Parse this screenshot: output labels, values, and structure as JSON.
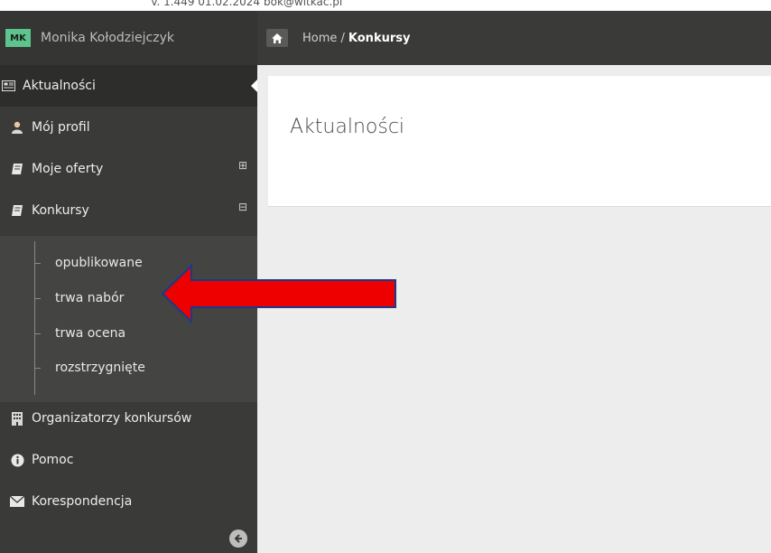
{
  "top": {
    "version": "v. 1.449 01.02.2024",
    "email_hint": "bok@witkac.pl"
  },
  "user": {
    "initials": "MK",
    "name": "Monika Kołodziejczyk"
  },
  "breadcrumb": {
    "home": "Home /",
    "current": "Konkursy"
  },
  "nav": {
    "items": [
      {
        "label": "Aktualności",
        "icon": "newspaper-icon"
      },
      {
        "label": "Mój profil",
        "icon": "user-icon"
      },
      {
        "label": "Moje oferty",
        "icon": "book-icon",
        "toggle": "⊞"
      },
      {
        "label": "Konkursy",
        "icon": "book-icon",
        "toggle": "⊟"
      },
      {
        "label": "Organizatorzy konkursów",
        "icon": "building-icon"
      },
      {
        "label": "Pomoc",
        "icon": "info-icon"
      },
      {
        "label": "Korespondencja",
        "icon": "envelope-icon"
      }
    ],
    "submenu": [
      "opublikowane",
      "trwa nabór",
      "trwa ocena",
      "rozstrzygnięte"
    ]
  },
  "panel": {
    "title": "Aktualności"
  },
  "colors": {
    "sidebar": "#3a3a39",
    "avatar": "#5cc48c",
    "arrow_fill": "#ee0000",
    "arrow_stroke": "#1a3a8a"
  }
}
